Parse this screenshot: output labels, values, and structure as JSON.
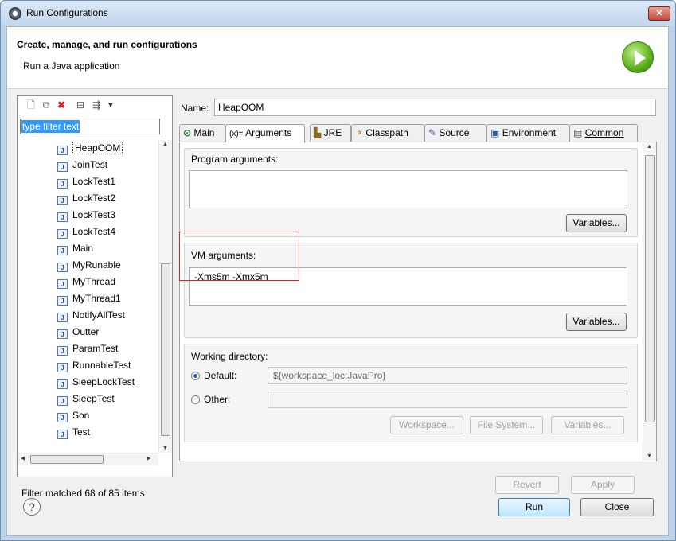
{
  "window": {
    "title": "Run Configurations",
    "close": "✕"
  },
  "header": {
    "title": "Create, manage, and run configurations",
    "subtitle": "Run a Java application"
  },
  "left": {
    "filter_placeholder": "type filter text",
    "items": [
      "HeapOOM",
      "JoinTest",
      "LockTest1",
      "LockTest2",
      "LockTest3",
      "LockTest4",
      "Main",
      "MyRunable",
      "MyThread",
      "MyThread1",
      "NotifyAllTest",
      "Outter",
      "ParamTest",
      "RunnableTest",
      "SleepLockTest",
      "SleepTest",
      "Son",
      "Test"
    ],
    "status": "Filter matched 68 of 85 items"
  },
  "right": {
    "name_label": "Name:",
    "name_value": "HeapOOM",
    "tabs": [
      "Main",
      "Arguments",
      "JRE",
      "Classpath",
      "Source",
      "Environment",
      "Common"
    ],
    "program_args_label": "Program arguments:",
    "program_args_value": "",
    "variables_label": "Variables...",
    "vm_args_label": "VM arguments:",
    "vm_args_value": "-Xms5m -Xmx5m",
    "workdir_label": "Working directory:",
    "default_label": "Default:",
    "default_value": "${workspace_loc:JavaPro}",
    "other_label": "Other:",
    "other_value": "",
    "workspace_btn": "Workspace...",
    "filesystem_btn": "File System...",
    "revert_btn": "Revert",
    "apply_btn": "Apply"
  },
  "footer": {
    "run": "Run",
    "close": "Close",
    "help": "?"
  }
}
